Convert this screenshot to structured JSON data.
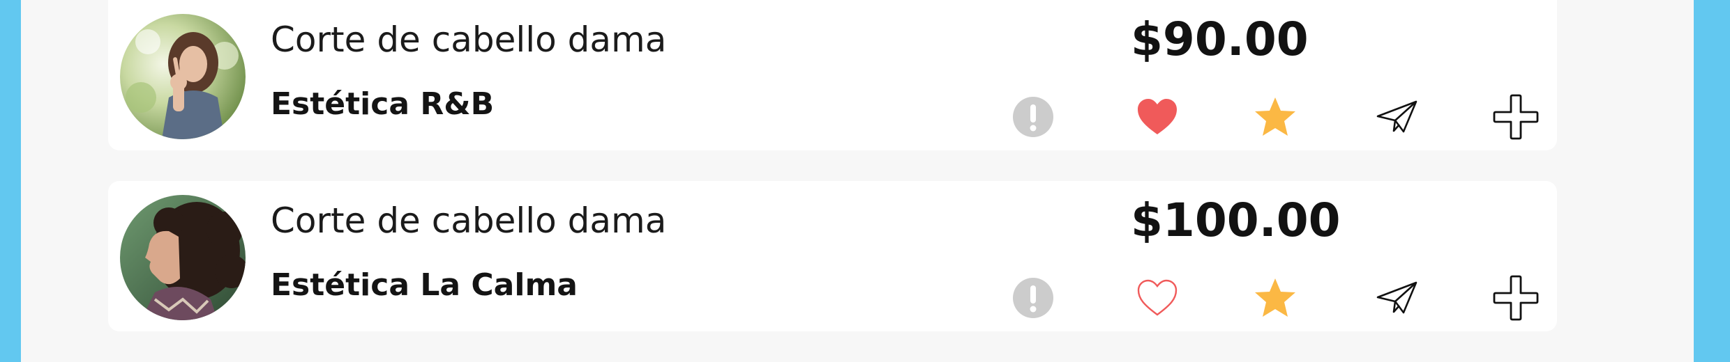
{
  "listings": [
    {
      "service": "Corte de cabello dama",
      "business": "Estética R&B",
      "price": "$90.00",
      "favorited": true,
      "icons": [
        "info-icon",
        "heart-filled-icon",
        "star-icon",
        "paper-plane-icon",
        "plus-icon"
      ]
    },
    {
      "service": "Corte de cabello dama",
      "business": "Estética La Calma",
      "price": "$100.00",
      "favorited": false,
      "icons": [
        "info-icon",
        "heart-outline-icon",
        "star-icon",
        "paper-plane-icon",
        "plus-icon"
      ]
    }
  ],
  "colors": {
    "background": "#62c8f0",
    "panel": "#f7f7f7",
    "card": "#ffffff",
    "heart": "#f05a5a",
    "star": "#fbb844",
    "info": "#cccccc"
  }
}
